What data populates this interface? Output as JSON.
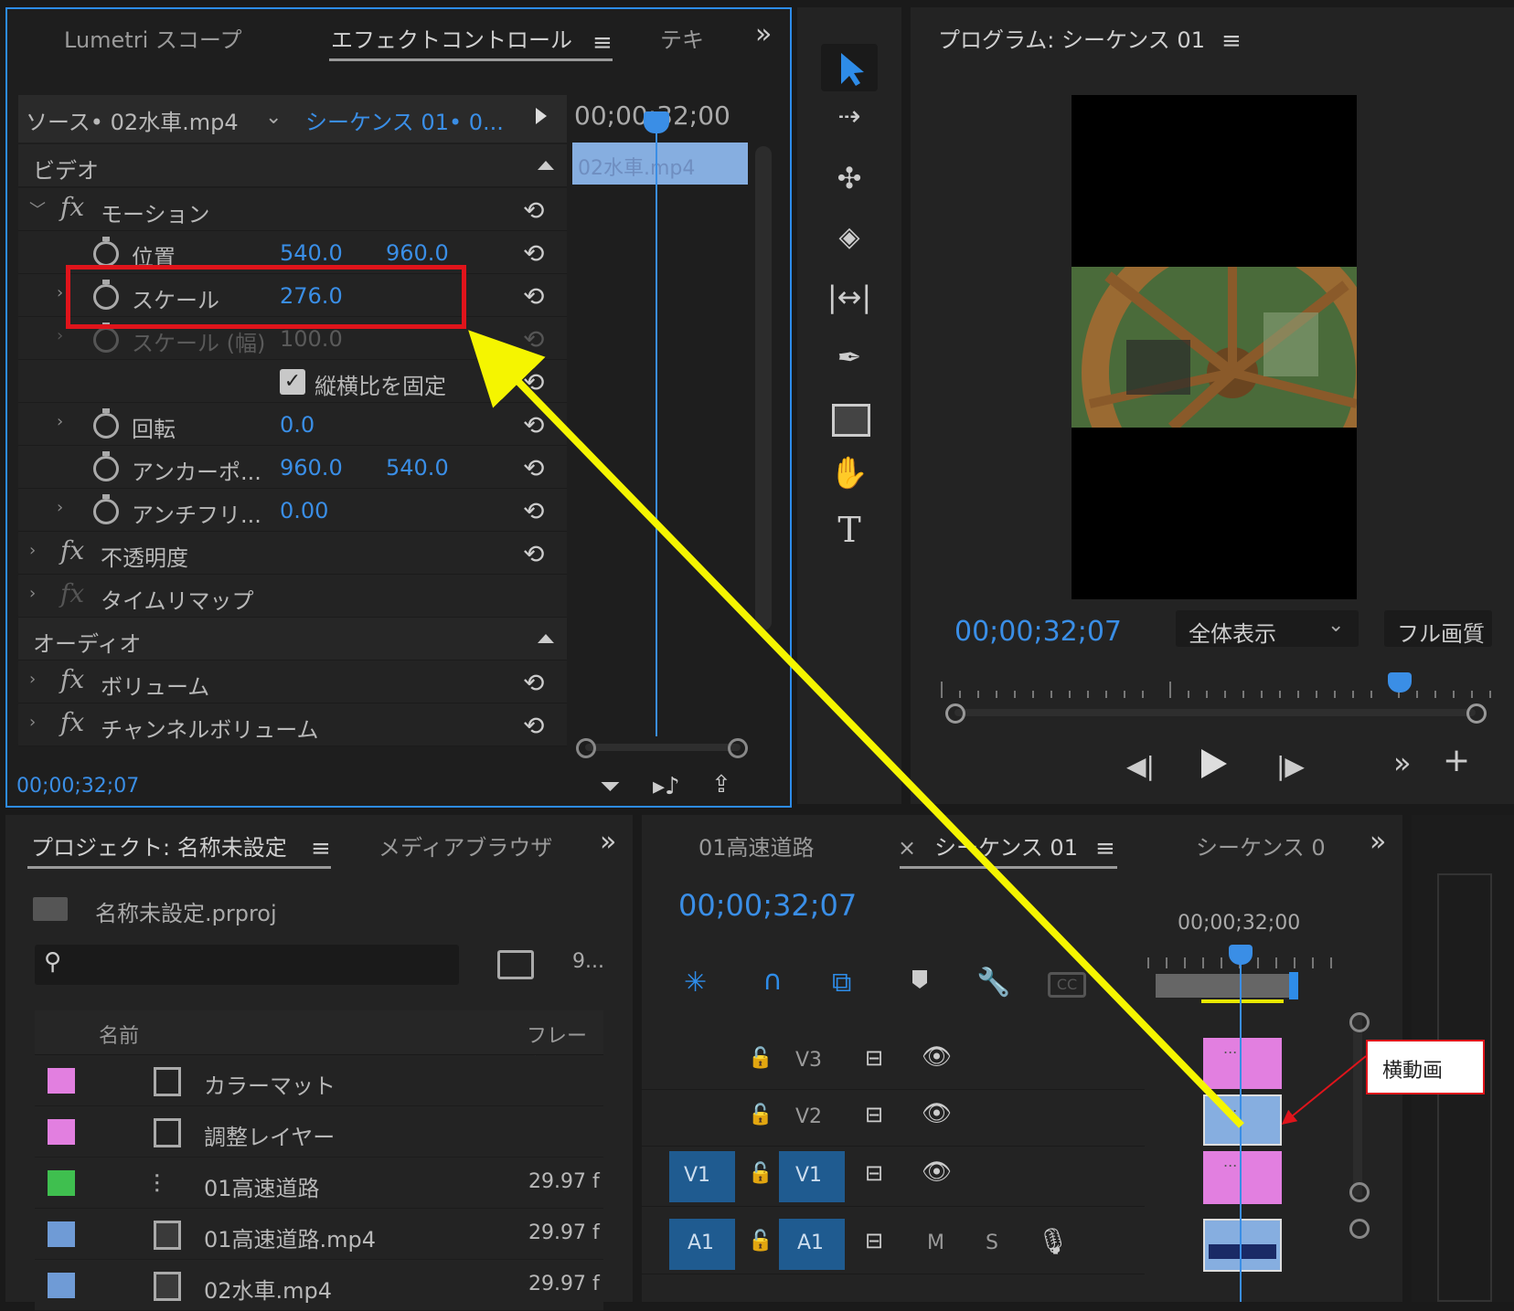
{
  "effect_panel": {
    "tabs": [
      "Lumetri スコープ",
      "エフェクトコントロール",
      "テキ"
    ],
    "overflow": "»",
    "source_label": "ソース• 02水車.mp4",
    "sequence_label": "シーケンス 01• 0...",
    "timecode_top": "00;00;32;00",
    "clip_name": "02水車.mp4",
    "video_header": "ビデオ",
    "audio_header": "オーディオ",
    "motion": "モーション",
    "position": {
      "label": "位置",
      "x": "540.0",
      "y": "960.0"
    },
    "scale": {
      "label": "スケール",
      "value": "276.0"
    },
    "scale_width": {
      "label": "スケール (幅)",
      "value": "100.0"
    },
    "lock_ratio": "縦横比を固定",
    "rotation": {
      "label": "回転",
      "value": "0.0"
    },
    "anchor": {
      "label": "アンカーポ...",
      "x": "960.0",
      "y": "540.0"
    },
    "antiflicker": {
      "label": "アンチフリ...",
      "value": "0.00"
    },
    "opacity": "不透明度",
    "time_remap": "タイムリマップ",
    "volume": "ボリューム",
    "channel_volume": "チャンネルボリューム",
    "timecode_bottom": "00;00;32;07"
  },
  "program_monitor": {
    "title": "プログラム: シーケンス 01",
    "timecode": "00;00;32;07",
    "zoom": "全体表示",
    "quality": "フル画質"
  },
  "project_panel": {
    "tabs": [
      "プロジェクト: 名称未設定",
      "メディアブラウザ"
    ],
    "overflow": "»",
    "project_file": "名称未設定.prproj",
    "items_count": "9...",
    "col_name": "名前",
    "col_frame": "フレーム",
    "items": [
      {
        "name": "カラーマット",
        "frame": "",
        "color": "#e27fe0"
      },
      {
        "name": "調整レイヤー",
        "frame": "",
        "color": "#e27fe0"
      },
      {
        "name": "01高速道路",
        "frame": "29.97 f",
        "color": "#3fbf4f"
      },
      {
        "name": "01高速道路.mp4",
        "frame": "29.97 f",
        "color": "#6f9bd6"
      },
      {
        "name": "02水車.mp4",
        "frame": "29.97 f",
        "color": "#6f9bd6"
      }
    ]
  },
  "timeline": {
    "tabs": [
      "01高速道路",
      "シーケンス 01",
      "シーケンス 0"
    ],
    "close": "×",
    "overflow": "»",
    "timecode": "00;00;32;07",
    "ruler_time": "00;00;32;00",
    "tracks": {
      "v3": "V3",
      "v2": "V2",
      "v1": "V1",
      "a1": "A1",
      "m": "M",
      "s": "S"
    },
    "clip_dots": "...",
    "annotation": "横動画"
  },
  "colors": {
    "accent": "#3a8ee6",
    "highlight_box": "#e0141b",
    "arrow": "#f5f500",
    "clip_pink": "#e27fe0",
    "clip_blue": "#86aee0"
  }
}
